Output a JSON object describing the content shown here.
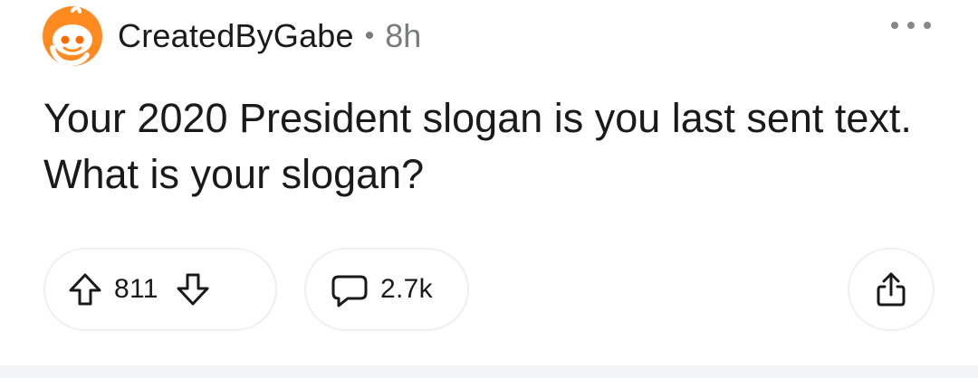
{
  "post": {
    "author": "CreatedByGabe",
    "separator": "•",
    "age": "8h",
    "title": "Your 2020 President slogan is you last sent text. What is your slogan?"
  },
  "actions": {
    "upvotes": "811",
    "comments": "2.7k"
  },
  "icons": {
    "avatar": "reddit-snoo-avatar",
    "more": "more-options-icon",
    "upvote": "upvote-arrow-icon",
    "downvote": "downvote-arrow-icon",
    "comment": "comment-bubble-icon",
    "share": "share-icon"
  },
  "colors": {
    "avatar_bg": "#ff8a1f",
    "text": "#1a1a1b",
    "meta": "#787c7e",
    "icon": "#1a1a1b",
    "border": "#edeff1"
  }
}
